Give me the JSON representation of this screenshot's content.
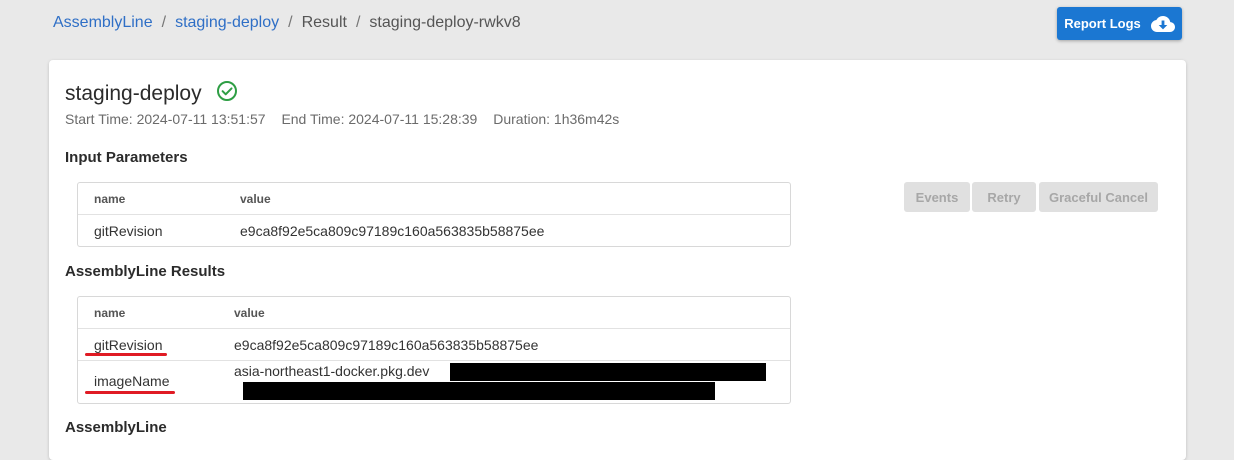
{
  "breadcrumb": {
    "items": [
      {
        "label": "AssemblyLine"
      },
      {
        "label": "staging-deploy"
      },
      {
        "label": "Result"
      },
      {
        "label": "staging-deploy-rwkv8"
      }
    ],
    "separator": "/"
  },
  "header": {
    "report_logs_label": "Report Logs",
    "report_logs_icon": "cloud-download-icon"
  },
  "run": {
    "title": "staging-deploy",
    "status_icon": "check-circle-icon",
    "status_color": "#2e9e44",
    "start_time": "Start Time: 2024-07-11 13:51:57",
    "end_time": "End Time: 2024-07-11 15:28:39",
    "duration": "Duration: 1h36m42s"
  },
  "actions": {
    "events_label": "Events",
    "retry_label": "Retry",
    "graceful_cancel_label": "Graceful Cancel"
  },
  "input_parameters": {
    "title": "Input Parameters",
    "columns": [
      "name",
      "value"
    ],
    "rows": [
      {
        "name": "gitRevision",
        "value": "e9ca8f92e5ca809c97189c160a563835b58875ee"
      }
    ]
  },
  "results": {
    "title": "AssemblyLine Results",
    "columns": [
      "name",
      "value"
    ],
    "rows": [
      {
        "name": "gitRevision",
        "value": "e9ca8f92e5ca809c97189c160a563835b58875ee"
      },
      {
        "name": "imageName",
        "value": "asia-northeast1-docker.pkg.dev"
      }
    ]
  },
  "next_section": {
    "title": "AssemblyLine"
  },
  "colors": {
    "accent": "#1b77d2",
    "link": "#2f6fc6",
    "annotation": "#e01b24"
  }
}
